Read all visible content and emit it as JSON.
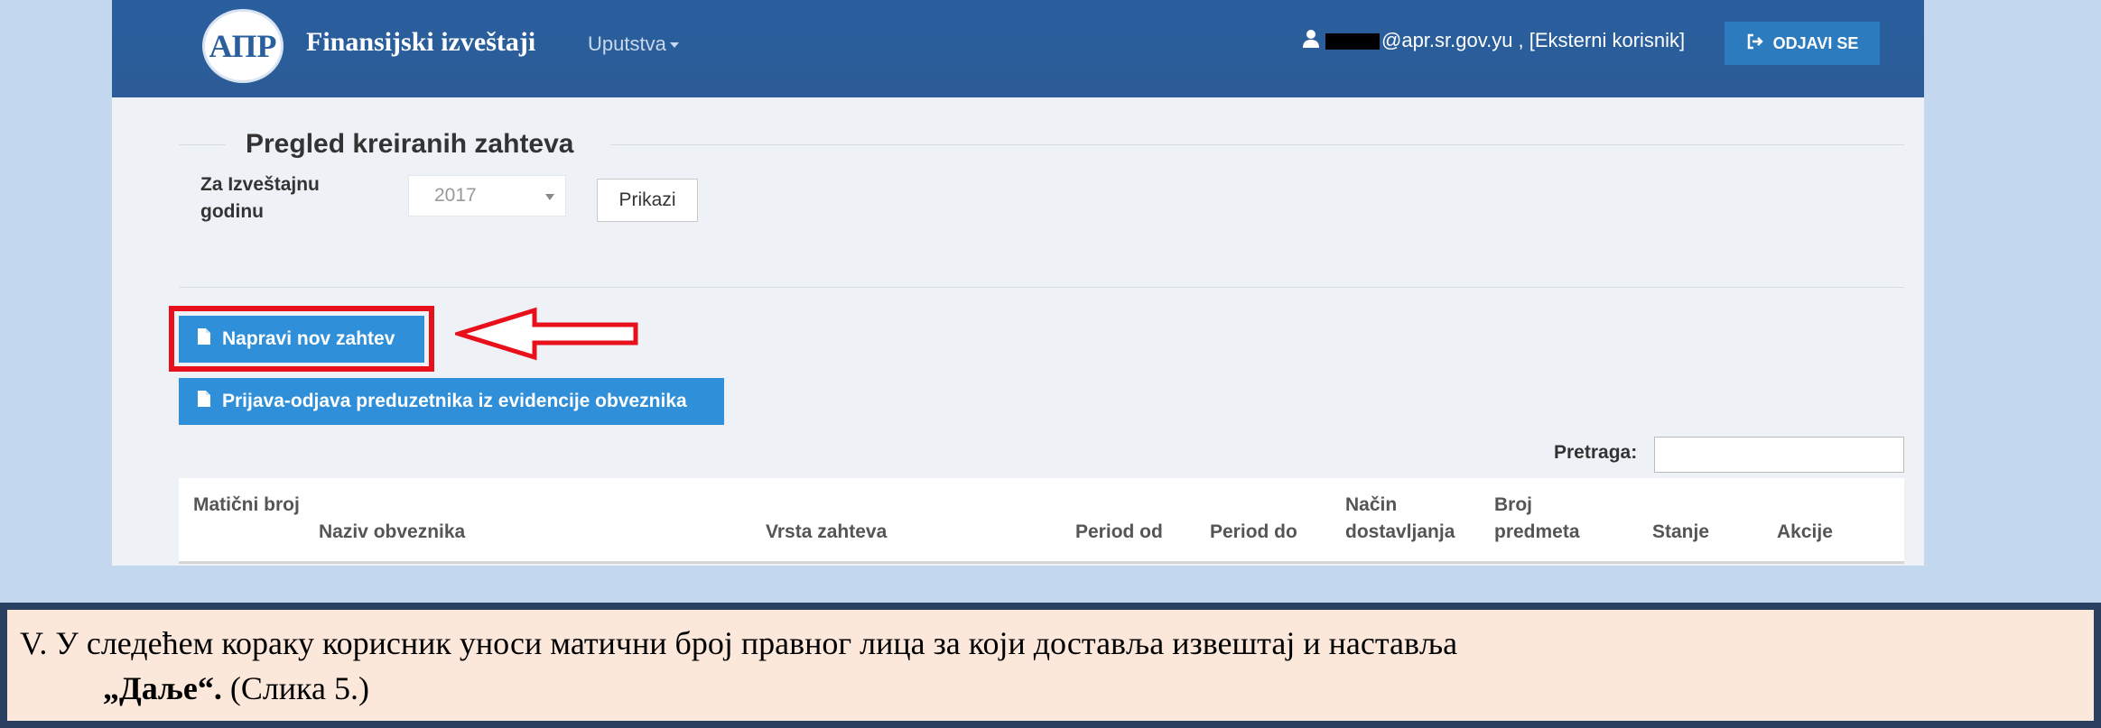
{
  "header": {
    "brand": "Finansijski izveštaji",
    "menu_label": "Uputstva",
    "user_suffix": "@apr.sr.gov.yu , [Eksterni korisnik]",
    "logout_label": "ODJAVI SE",
    "logo_text": "АПР"
  },
  "page": {
    "title": "Pregled kreiranih zahteva",
    "year_label": "Za Izveštajnu godinu",
    "year_value": "2017",
    "show_button": "Prikazi",
    "new_request_button": "Napravi nov zahtev",
    "register_button": "Prijava-odjava preduzetnika iz evidencije obveznika",
    "search_label": "Pretraga:",
    "search_value": ""
  },
  "table": {
    "columns": [
      "Matični broj",
      "Naziv obveznika",
      "Vrsta zahteva",
      "Period od",
      "Period do",
      "Način dostavljanja",
      "Broj predmeta",
      "Stanje",
      "Akcije"
    ]
  },
  "caption": {
    "line1": "V. У следећем кораку корисник уноси матични број правног лица за који доставља извештај и наставља",
    "line2_bold": "„Даље“.",
    "line2_rest": " (Слика 5.)"
  },
  "colors": {
    "navbar": "#2a5f9e",
    "primary_button": "#2f8fd8",
    "highlight": "#e8101b",
    "caption_bg": "#fce7db"
  },
  "icons": {
    "user": "user-icon",
    "logout": "logout-icon",
    "document": "document-icon",
    "arrow": "arrow-left-icon"
  }
}
